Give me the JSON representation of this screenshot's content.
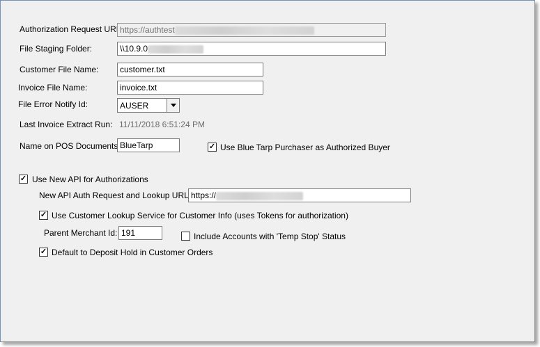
{
  "auth_request_url": {
    "label": "Authorization Request URL:",
    "value": "https://authtest"
  },
  "file_staging_folder": {
    "label": "File Staging Folder:",
    "value": "\\\\10.9.0"
  },
  "customer_file_name": {
    "label": "Customer File Name:",
    "value": "customer.txt"
  },
  "invoice_file_name": {
    "label": "Invoice File Name:",
    "value": "invoice.txt"
  },
  "file_error_notify": {
    "label": "File Error Notify Id:",
    "value": "AUSER"
  },
  "last_invoice_extract": {
    "label": "Last Invoice Extract Run:",
    "value": "11/11/2018 6:51:24 PM"
  },
  "name_on_pos": {
    "label": "Name on POS Documents:",
    "value": "BlueTarp"
  },
  "use_bluetarp_purchaser": {
    "label": "Use Blue Tarp Purchaser as Authorized Buyer",
    "checked": true
  },
  "use_new_api": {
    "label": "Use New API for Authorizations",
    "checked": true
  },
  "new_api_url": {
    "label": "New API Auth Request and Lookup URL:",
    "value": "https://"
  },
  "use_customer_lookup": {
    "label": "Use Customer Lookup Service for Customer Info (uses Tokens for authorization)",
    "checked": true
  },
  "parent_merchant": {
    "label": "Parent Merchant Id:",
    "value": "191"
  },
  "include_temp_stop": {
    "label": "Include Accounts with 'Temp Stop' Status",
    "checked": false
  },
  "default_deposit_hold": {
    "label": "Default to Deposit Hold in Customer Orders",
    "checked": true
  },
  "check_glyph": "✓"
}
